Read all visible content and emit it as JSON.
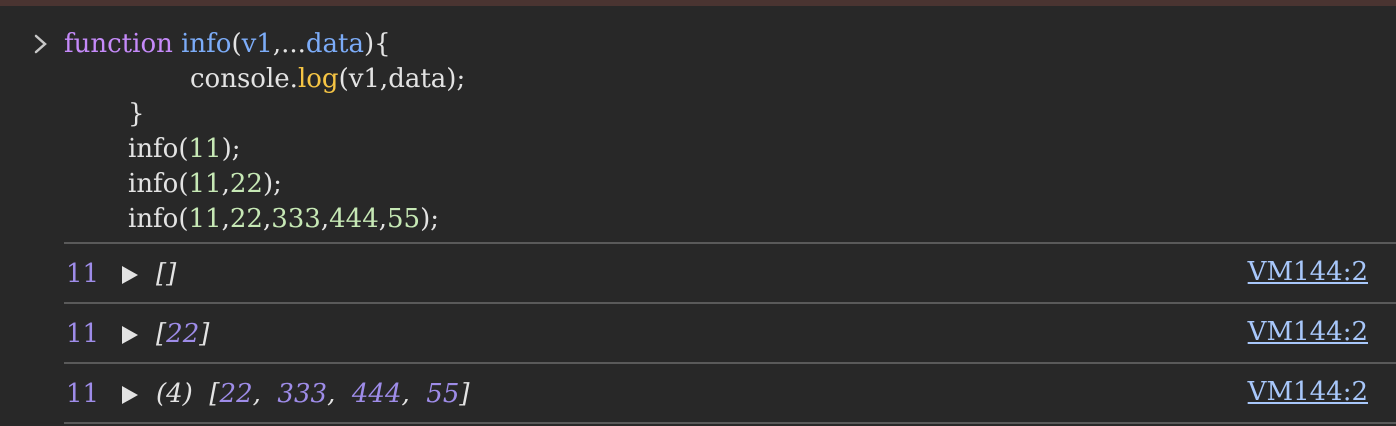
{
  "console": {
    "input": {
      "line1": {
        "kw": "function",
        "fn": "info",
        "open": "(",
        "p1": "v1",
        "sep": ",...",
        "p2": "data",
        "close": "){"
      },
      "line2": {
        "obj": "console.",
        "method": "log",
        "args": "(v1,data);"
      },
      "line3": {
        "text": "}"
      },
      "line4": {
        "call": "info(",
        "n1": "11",
        "end": ");"
      },
      "line5": {
        "call": "info(",
        "n1": "11",
        "c1": ",",
        "n2": "22",
        "end": ");"
      },
      "line6": {
        "call": "info(",
        "n1": "11",
        "c1": ",",
        "n2": "22",
        "c2": ",",
        "n3": "333",
        "c3": ",",
        "n4": "444",
        "c4": ",",
        "n5": "55",
        "end": ");"
      }
    },
    "output": [
      {
        "first": "11",
        "open": "[",
        "items": [],
        "close": "]",
        "source": "VM144:2"
      },
      {
        "first": "11",
        "open": "[",
        "items": [
          "22"
        ],
        "close": "]",
        "source": "VM144:2"
      },
      {
        "first": "11",
        "length": "(4)",
        "open": "[",
        "items": [
          "22",
          "333",
          "444",
          "55"
        ],
        "close": "]",
        "source": "VM144:2"
      }
    ]
  },
  "colors": {
    "background": "#282828",
    "keyword": "#c58af9",
    "function": "#7cacf8",
    "method": "#f6c544",
    "number": "#c6e8b5",
    "log_number": "#9e8ce8",
    "link": "#a8c7fa"
  },
  "icons": {
    "prompt": "chevron-right-icon",
    "expand": "triangle-right-icon"
  }
}
